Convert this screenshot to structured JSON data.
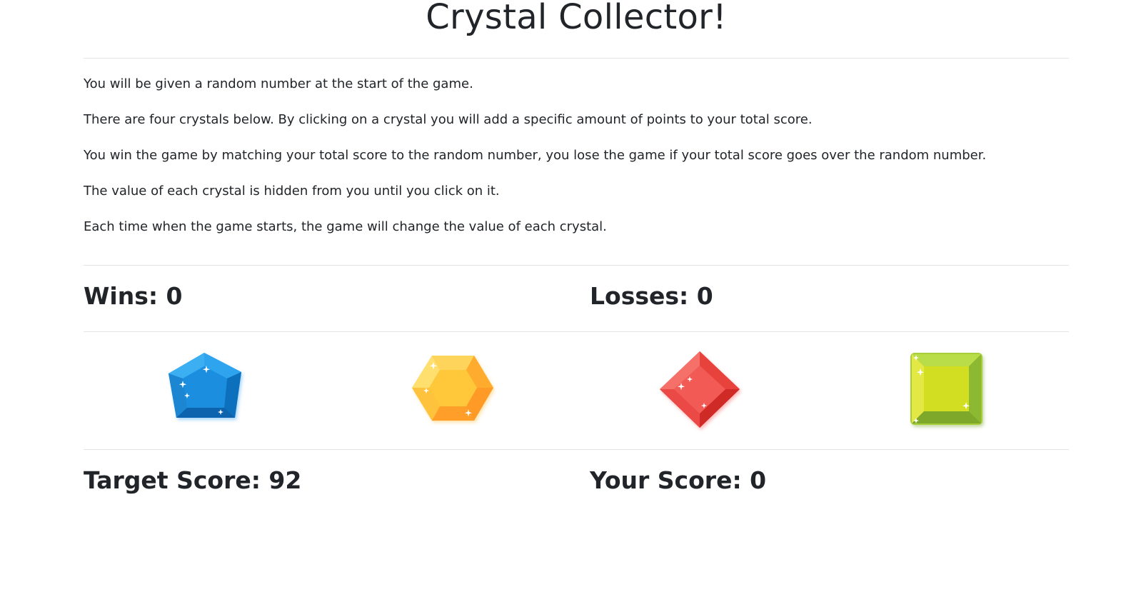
{
  "page": {
    "title": "Crystal Collector!"
  },
  "instructions": [
    "You will be given a random number at the start of the game.",
    "There are four crystals below. By clicking on a crystal you will add a specific amount of points to your total score.",
    "You win the game by matching your total score to the random number, you lose the game if your total score goes over the random number.",
    "The value of each crystal is hidden from you until you click on it.",
    "Each time when the game starts, the game will change the value of each crystal."
  ],
  "stats": {
    "wins_label": "Wins: 0",
    "losses_label": "Losses: 0"
  },
  "crystals": [
    {
      "name": "blue-pentagon-crystal",
      "icon": "blue-crystal-icon",
      "color": "#1a8ee0"
    },
    {
      "name": "orange-hexagon-crystal",
      "icon": "orange-crystal-icon",
      "color": "#ffb22e"
    },
    {
      "name": "red-diamond-crystal",
      "icon": "red-crystal-icon",
      "color": "#ee4b45"
    },
    {
      "name": "green-square-crystal",
      "icon": "green-crystal-icon",
      "color": "#a8cd3a"
    }
  ],
  "scores": {
    "target_label": "Target Score: 92",
    "your_label": "Your Score: 0"
  }
}
